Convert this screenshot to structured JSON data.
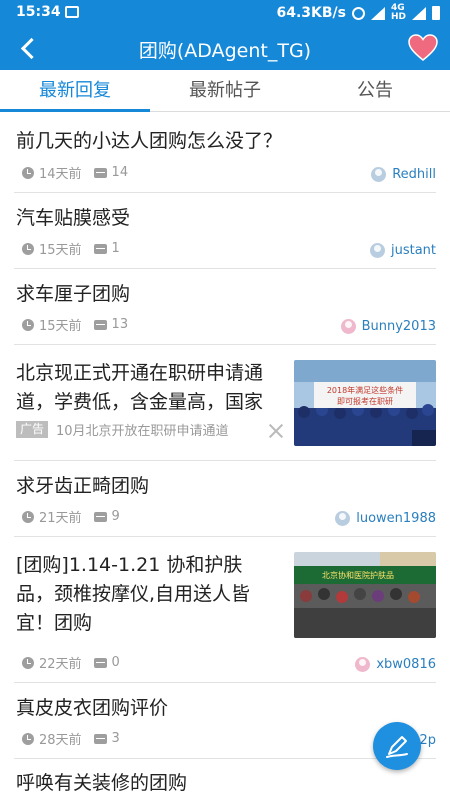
{
  "status": {
    "time": "15:34",
    "speed": "64.3KB/s",
    "net_top": "4G",
    "net_bottom": "HD"
  },
  "header": {
    "title": "团购(ADAgent_TG)"
  },
  "tabs": [
    {
      "label": "最新回复",
      "active": true
    },
    {
      "label": "最新帖子",
      "active": false
    },
    {
      "label": "公告",
      "active": false
    }
  ],
  "posts": [
    {
      "title": "前几天的小达人团购怎么没了？",
      "time": "14天前",
      "comments": "14",
      "user": "Redhill"
    },
    {
      "title": "汽车贴膜感受",
      "time": "15天前",
      "comments": "1",
      "user": "justant"
    },
    {
      "title": "求车厘子团购",
      "time": "15天前",
      "comments": "13",
      "user": "Bunny2013"
    },
    {
      "title": "北京现正式开通在职研申请通道，学费低，含金量高，国家",
      "ad_tag": "广告",
      "ad_sub": "10月北京开放在职研申请通道",
      "image_text_1": "2018年满足这些条件",
      "image_text_2": "即可报考在职研"
    },
    {
      "title": "求牙齿正畸团购",
      "time": "21天前",
      "comments": "9",
      "user": "luowen1988"
    },
    {
      "title": "[团购]1.14-1.21 协和护肤品，颈椎按摩仪,自用送人皆宜！团购",
      "time": "22天前",
      "comments": "0",
      "user": "xbw0816",
      "image_text": "北京协和医院护肤品"
    },
    {
      "title": "真皮皮衣团购评价",
      "time": "28天前",
      "comments": "3",
      "user": "2p"
    },
    {
      "title": "呼唤有关装修的团购"
    }
  ],
  "colors": {
    "brand": "#1688d8",
    "link": "#2a7fbf",
    "heart": "#f06a7f"
  }
}
